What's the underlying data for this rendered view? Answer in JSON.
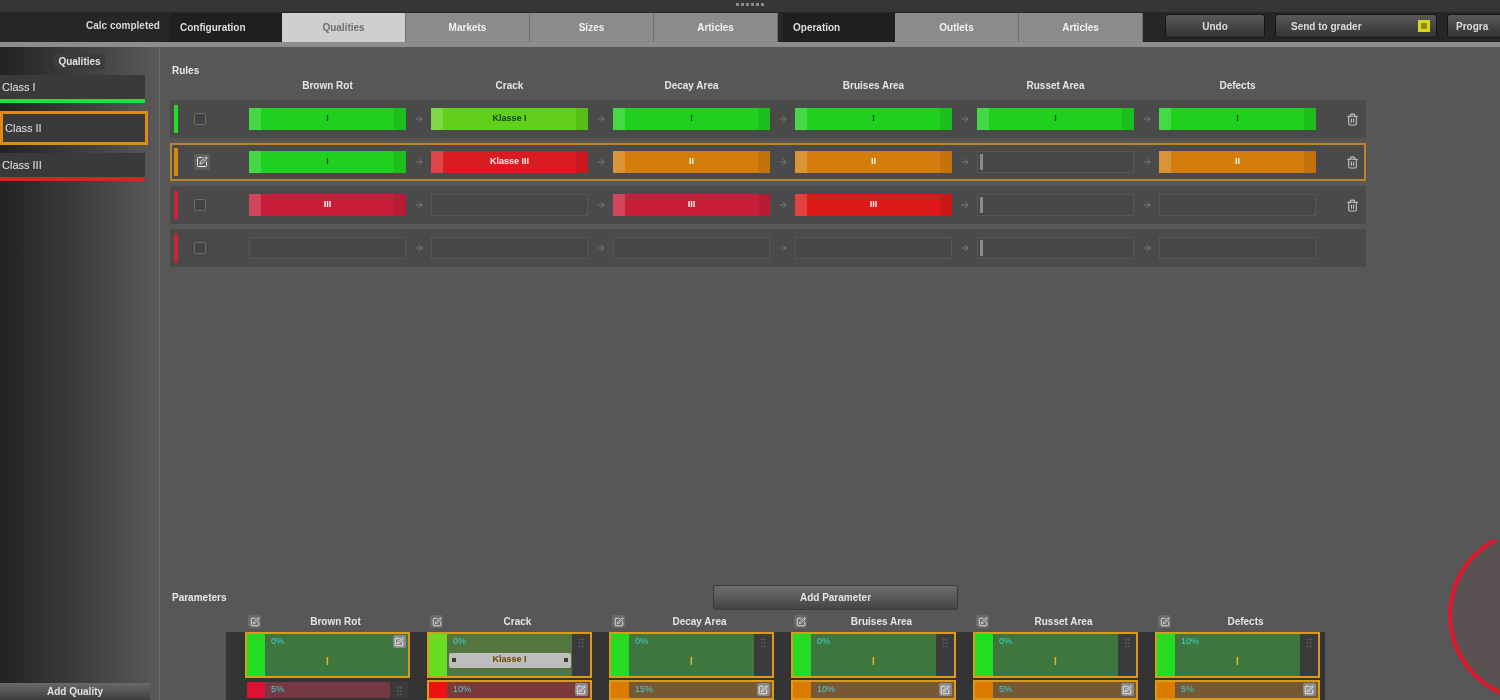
{
  "top_bar": {
    "status": "Calc completed",
    "groups": [
      {
        "label": "Configuration",
        "tabs": [
          {
            "label": "Qualities",
            "selected": true
          },
          {
            "label": "Markets",
            "selected": false
          },
          {
            "label": "Sizes",
            "selected": false
          },
          {
            "label": "Articles",
            "selected": false
          }
        ]
      },
      {
        "label": "Operation",
        "tabs": [
          {
            "label": "Outlets",
            "selected": false
          },
          {
            "label": "Articles",
            "selected": false
          }
        ]
      }
    ],
    "buttons": [
      {
        "label": "Undo",
        "kind": "plain"
      },
      {
        "label": "Send to grader",
        "kind": "badge"
      },
      {
        "label": "Progra",
        "kind": "plain"
      }
    ]
  },
  "sidebar": {
    "title": "Qualities",
    "items": [
      {
        "label": "Class I",
        "color": "#22dd44",
        "selected": false
      },
      {
        "label": "Class II",
        "color": "#e08c10",
        "selected": true
      },
      {
        "label": "Class III",
        "color": "#dd2020",
        "selected": false
      }
    ],
    "add_button": "Add Quality"
  },
  "rules": {
    "title": "Rules",
    "columns": [
      "Brown Rot",
      "Crack",
      "Decay Area",
      "Bruises Area",
      "Russet Area",
      "Defects"
    ],
    "rows": [
      {
        "selected": false,
        "color": "#22dd22",
        "deletable": true,
        "cells": [
          {
            "kind": "filled",
            "value": "I",
            "color": "#1fd01f"
          },
          {
            "kind": "filled",
            "value": "Klasse I",
            "color": "#62cf1c"
          },
          {
            "kind": "filled",
            "value": "I",
            "color": "#1fd01f"
          },
          {
            "kind": "filled",
            "value": "I",
            "color": "#1fd01f"
          },
          {
            "kind": "filled",
            "value": "I",
            "color": "#1fd01f"
          },
          {
            "kind": "filled",
            "value": "I",
            "color": "#1fd01f"
          }
        ]
      },
      {
        "selected": true,
        "color": "#d4880f",
        "deletable": true,
        "cells": [
          {
            "kind": "filled",
            "value": "I",
            "color": "#1fd01f"
          },
          {
            "kind": "filled",
            "value": "Klasse III",
            "color": "#d81c22"
          },
          {
            "kind": "filled",
            "value": "II",
            "color": "#d47c0c"
          },
          {
            "kind": "filled",
            "value": "II",
            "color": "#d47c0c"
          },
          {
            "kind": "empty",
            "marker": true
          },
          {
            "kind": "filled",
            "value": "II",
            "color": "#d47c0c"
          }
        ]
      },
      {
        "selected": false,
        "color": "#cc2233",
        "deletable": true,
        "cells": [
          {
            "kind": "filled",
            "value": "III",
            "color": "#c81e3a"
          },
          {
            "kind": "empty",
            "marker": false
          },
          {
            "kind": "filled",
            "value": "III",
            "color": "#c81e3a"
          },
          {
            "kind": "filled",
            "value": "III",
            "color": "#dd1818"
          },
          {
            "kind": "empty",
            "marker": true
          },
          {
            "kind": "empty",
            "marker": false
          }
        ]
      },
      {
        "selected": false,
        "color": "#cc2233",
        "deletable": false,
        "cells": [
          {
            "kind": "empty",
            "marker": false
          },
          {
            "kind": "empty",
            "marker": false
          },
          {
            "kind": "empty",
            "marker": false
          },
          {
            "kind": "empty",
            "marker": false
          },
          {
            "kind": "empty",
            "marker": true
          },
          {
            "kind": "empty",
            "marker": false
          }
        ]
      }
    ]
  },
  "parameters": {
    "title": "Parameters",
    "add_button": "Add Parameter",
    "columns": [
      {
        "label": "Brown Rot",
        "cards": [
          {
            "threshold": "0%",
            "value": "I",
            "kind": "text",
            "color": "#22dd22",
            "selected": true,
            "editable": true
          },
          {
            "threshold": "5%",
            "color": "#dd1133",
            "selected": false,
            "editable": false
          }
        ]
      },
      {
        "label": "Crack",
        "cards": [
          {
            "threshold": "0%",
            "value": "Klasse I",
            "kind": "selector",
            "color": "#66dd22",
            "selected": true,
            "editable": false
          },
          {
            "threshold": "10%",
            "color": "#ee1111",
            "selected": true,
            "editable": true
          }
        ]
      },
      {
        "label": "Decay Area",
        "cards": [
          {
            "threshold": "0%",
            "value": "I",
            "kind": "text",
            "color": "#22dd22",
            "selected": true,
            "editable": false
          },
          {
            "threshold": "15%",
            "color": "#dd7a00",
            "selected": true,
            "editable": true
          }
        ]
      },
      {
        "label": "Bruises Area",
        "cards": [
          {
            "threshold": "0%",
            "value": "I",
            "kind": "text",
            "color": "#22dd22",
            "selected": true,
            "editable": false
          },
          {
            "threshold": "10%",
            "color": "#dd7a00",
            "selected": true,
            "editable": true
          }
        ]
      },
      {
        "label": "Russet Area",
        "cards": [
          {
            "threshold": "0%",
            "value": "I",
            "kind": "text",
            "color": "#22dd22",
            "selected": true,
            "editable": false
          },
          {
            "threshold": "5%",
            "color": "#dd7a00",
            "selected": true,
            "editable": true
          }
        ]
      },
      {
        "label": "Defects",
        "cards": [
          {
            "threshold": "10%",
            "value": "I",
            "kind": "text",
            "color": "#22dd22",
            "selected": true,
            "editable": false
          },
          {
            "threshold": "5%",
            "color": "#dd7a00",
            "selected": true,
            "editable": true
          }
        ]
      }
    ]
  }
}
